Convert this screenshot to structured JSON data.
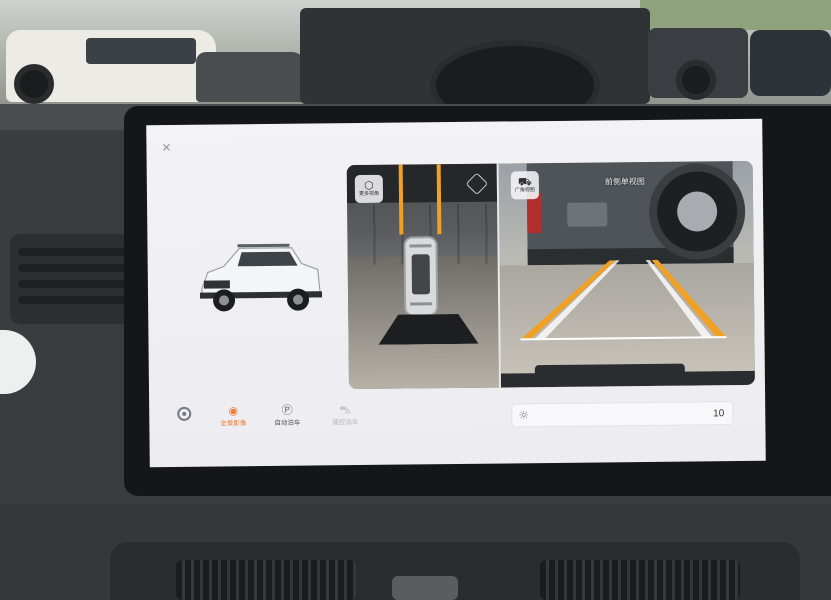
{
  "screen": {
    "close": "×",
    "views": {
      "multi_view": {
        "label": "更多视角",
        "icon": "cube-icon"
      },
      "wide_angle": {
        "label": "广角视图",
        "icon": "car-wide-icon"
      },
      "rear_title": "前侧单视图"
    },
    "toolbar": {
      "settings": "⚙",
      "items": [
        {
          "label": "全景影像",
          "icon": "camera-car-icon",
          "state": "active"
        },
        {
          "label": "自动泊车",
          "icon": "parking-icon",
          "state": "normal"
        },
        {
          "label": "遥控泊车",
          "icon": "remote-car-icon",
          "state": "disabled"
        }
      ]
    },
    "brightness": {
      "icon": "sun-icon",
      "value": "10"
    },
    "accent_color": "#f07c2a",
    "guide_color": "#f0a123"
  }
}
